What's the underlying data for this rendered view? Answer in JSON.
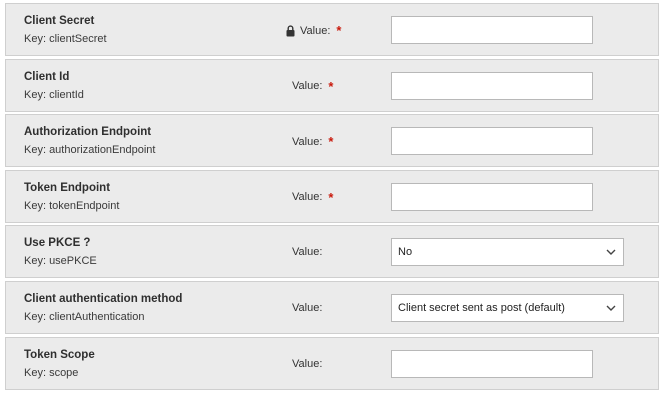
{
  "required_marker": "*",
  "value_label": "Value:",
  "fields": [
    {
      "id": "client-secret",
      "name": "Client Secret",
      "key": "Key: clientSecret",
      "required": true,
      "locked": true,
      "type": "text",
      "value": ""
    },
    {
      "id": "client-id",
      "name": "Client Id",
      "key": "Key: clientId",
      "required": true,
      "locked": false,
      "type": "text",
      "value": ""
    },
    {
      "id": "authorization-endpoint",
      "name": "Authorization Endpoint",
      "key": "Key: authorizationEndpoint",
      "required": true,
      "locked": false,
      "type": "text",
      "value": ""
    },
    {
      "id": "token-endpoint",
      "name": "Token Endpoint",
      "key": "Key: tokenEndpoint",
      "required": true,
      "locked": false,
      "type": "text",
      "value": ""
    },
    {
      "id": "use-pkce",
      "name": "Use PKCE ?",
      "key": "Key: usePKCE",
      "required": false,
      "locked": false,
      "type": "select",
      "value": "No"
    },
    {
      "id": "client-authentication-method",
      "name": "Client authentication method",
      "key": "Key: clientAuthentication",
      "required": false,
      "locked": false,
      "type": "select",
      "value": "Client secret sent as post (default)"
    },
    {
      "id": "token-scope",
      "name": "Token Scope",
      "key": "Key: scope",
      "required": false,
      "locked": false,
      "type": "text",
      "value": ""
    }
  ],
  "icons": {
    "lock": "lock-icon",
    "chevron": "chevron-down-icon"
  },
  "colors": {
    "row_background": "#ebebeb",
    "row_border": "#cfcfcf",
    "required_marker": "#c9190b",
    "input_border": "#b8b8b8"
  }
}
